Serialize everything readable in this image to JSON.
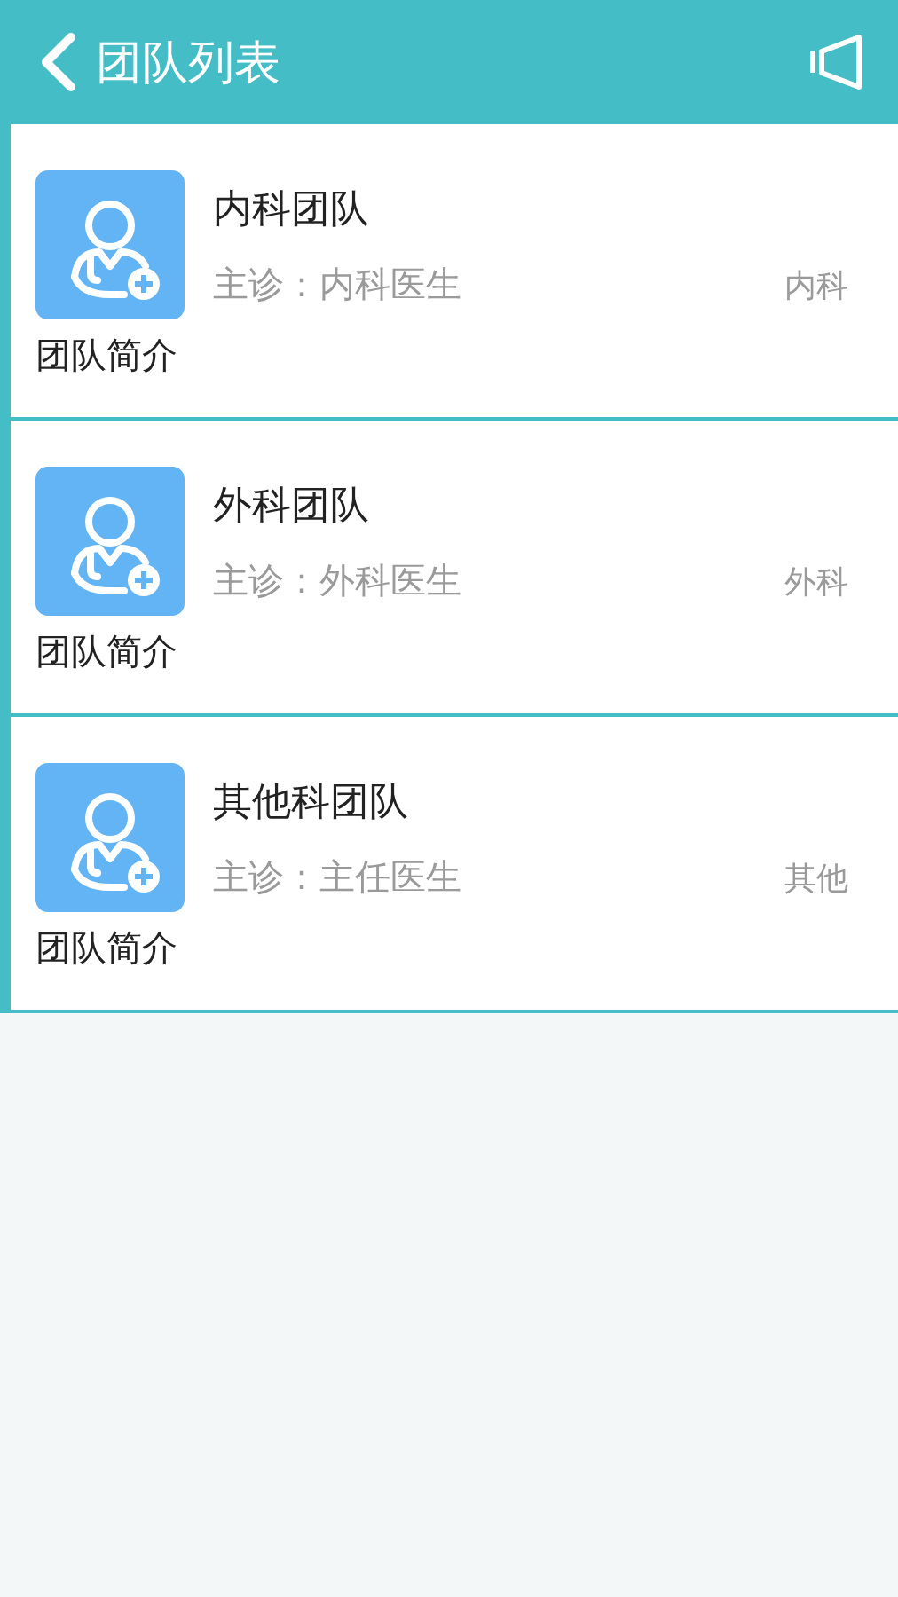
{
  "header": {
    "title": "团队列表"
  },
  "teams": [
    {
      "name": "内科团队",
      "doctor": "主诊：内科医生",
      "department": "内科",
      "intro": "团队简介"
    },
    {
      "name": "外科团队",
      "doctor": "主诊：外科医生",
      "department": "外科",
      "intro": "团队简介"
    },
    {
      "name": "其他科团队",
      "doctor": "主诊：主任医生",
      "department": "其他",
      "intro": "团队简介"
    }
  ]
}
